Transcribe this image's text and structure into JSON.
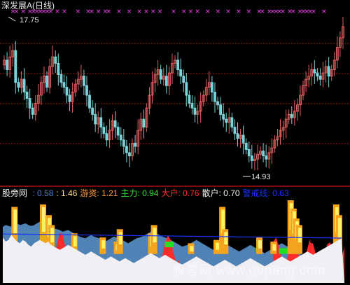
{
  "header": {
    "title": "深发展A",
    "period": "(日线)"
  },
  "indicator": {
    "name": "股旁网",
    "values": [
      {
        "label": "",
        "value": "0.58",
        "color": "#4f7fdc"
      },
      {
        "label": "",
        "value": "1.46",
        "color": "#ffe27a"
      },
      {
        "label": "游资:",
        "value": "1.21",
        "color": "#ff9a3c"
      },
      {
        "label": "主力:",
        "value": "0.94",
        "color": "#2fe02f"
      },
      {
        "label": "大户:",
        "value": "0.76",
        "color": "#ff3030"
      },
      {
        "label": "散户:",
        "value": "0.70",
        "color": "#f2f2f2"
      },
      {
        "label": "警戒线:",
        "value": "0.63",
        "color": "#1a33ff"
      }
    ]
  },
  "watermark": "股旁网  www.gupang.com",
  "colors": {
    "up": "#e06060",
    "down": "#7ad3d8",
    "grid": "#9a1a1a",
    "signal": "#ff44ff",
    "retail": "#f0f0f4",
    "mainforce": "#4f82b5",
    "hotmoney": "#f5a41f",
    "bigholder": "#ff2a2a",
    "main_green": "#22e022",
    "guard": "#1a33ff"
  },
  "chart_data": {
    "type": "candlestick",
    "price_annotations": {
      "high": "17.75",
      "low": "14.93"
    },
    "price_high": 17.75,
    "price_low": 14.93,
    "signal_marker": "×",
    "signal_positions": [
      0.03,
      0.04,
      0.06,
      0.08,
      0.09,
      0.1,
      0.11,
      0.12,
      0.13,
      0.14,
      0.16,
      0.18,
      0.22,
      0.25,
      0.26,
      0.28,
      0.3,
      0.31,
      0.34,
      0.37,
      0.4,
      0.42,
      0.44,
      0.46,
      0.5,
      0.53,
      0.55,
      0.57,
      0.6,
      0.63,
      0.66,
      0.69,
      0.72,
      0.75,
      0.76,
      0.78,
      0.79,
      0.8,
      0.81,
      0.82,
      0.84,
      0.85,
      0.87,
      0.88,
      0.89,
      0.9,
      0.91,
      0.94
    ],
    "candles_close_norm": [
      0.72,
      0.66,
      0.74,
      0.78,
      0.58,
      0.55,
      0.6,
      0.52,
      0.48,
      0.42,
      0.38,
      0.45,
      0.5,
      0.58,
      0.62,
      0.55,
      0.68,
      0.74,
      0.7,
      0.63,
      0.58,
      0.55,
      0.5,
      0.46,
      0.52,
      0.57,
      0.6,
      0.62,
      0.56,
      0.5,
      0.42,
      0.38,
      0.32,
      0.36,
      0.3,
      0.26,
      0.22,
      0.28,
      0.34,
      0.3,
      0.25,
      0.22,
      0.18,
      0.14,
      0.12,
      0.2,
      0.18,
      0.28,
      0.35,
      0.3,
      0.42,
      0.5,
      0.58,
      0.63,
      0.66,
      0.6,
      0.62,
      0.56,
      0.64,
      0.7,
      0.72,
      0.66,
      0.62,
      0.58,
      0.5,
      0.45,
      0.42,
      0.38,
      0.4,
      0.46,
      0.5,
      0.55,
      0.58,
      0.52,
      0.46,
      0.44,
      0.38,
      0.35,
      0.33,
      0.36,
      0.3,
      0.26,
      0.23,
      0.25,
      0.2,
      0.16,
      0.12,
      0.09,
      0.1,
      0.13,
      0.15,
      0.12,
      0.1,
      0.14,
      0.17,
      0.22,
      0.24,
      0.28,
      0.3,
      0.35,
      0.38,
      0.36,
      0.4,
      0.44,
      0.5,
      0.56,
      0.6,
      0.62,
      0.66,
      0.64,
      0.62,
      0.6,
      0.64,
      0.68,
      0.62,
      0.66,
      0.72,
      0.8,
      0.86,
      0.93
    ],
    "indicator_series": [
      "散户",
      "主力",
      "游资",
      "大户",
      "警戒线"
    ],
    "retail_norm": [
      0.55,
      0.5,
      0.52,
      0.58,
      0.54,
      0.5,
      0.48,
      0.52,
      0.5,
      0.46,
      0.44,
      0.48,
      0.5,
      0.52,
      0.5,
      0.48,
      0.5,
      0.46,
      0.44,
      0.42,
      0.4,
      0.42,
      0.44,
      0.46,
      0.44,
      0.42,
      0.4,
      0.38,
      0.36,
      0.34,
      0.36,
      0.38,
      0.36,
      0.34,
      0.32,
      0.3,
      0.28,
      0.3,
      0.32,
      0.3,
      0.28,
      0.26,
      0.28,
      0.3,
      0.28,
      0.26,
      0.24,
      0.26,
      0.28,
      0.3,
      0.32,
      0.34,
      0.36,
      0.34,
      0.32,
      0.3,
      0.32,
      0.34,
      0.32,
      0.3,
      0.28,
      0.26,
      0.24,
      0.22,
      0.24,
      0.26,
      0.28,
      0.3,
      0.32,
      0.3,
      0.28,
      0.26,
      0.24,
      0.22,
      0.2,
      0.22,
      0.24,
      0.26,
      0.28,
      0.26,
      0.24,
      0.22,
      0.2,
      0.22,
      0.24,
      0.26,
      0.28,
      0.3,
      0.28,
      0.26,
      0.24,
      0.22,
      0.2,
      0.22,
      0.24,
      0.26,
      0.28,
      0.3,
      0.32,
      0.3,
      0.28,
      0.26,
      0.28,
      0.3,
      0.32,
      0.34,
      0.36,
      0.38,
      0.36,
      0.34,
      0.36,
      0.38,
      0.4,
      0.42,
      0.44,
      0.46,
      0.48,
      0.5,
      0.52,
      0.54
    ],
    "main_norm": [
      0.68,
      0.7,
      0.69,
      0.68,
      0.7,
      0.72,
      0.7,
      0.71,
      0.72,
      0.7,
      0.69,
      0.7,
      0.72,
      0.74,
      0.73,
      0.72,
      0.7,
      0.68,
      0.66,
      0.65,
      0.64,
      0.62,
      0.63,
      0.64,
      0.62,
      0.6,
      0.58,
      0.56,
      0.55,
      0.54,
      0.56,
      0.58,
      0.56,
      0.55,
      0.54,
      0.52,
      0.5,
      0.52,
      0.54,
      0.56,
      0.55,
      0.54,
      0.52,
      0.5,
      0.48,
      0.5,
      0.52,
      0.54,
      0.55,
      0.56,
      0.58,
      0.6,
      0.62,
      0.61,
      0.6,
      0.58,
      0.56,
      0.55,
      0.54,
      0.52,
      0.5,
      0.48,
      0.46,
      0.44,
      0.45,
      0.46,
      0.48,
      0.5,
      0.52,
      0.5,
      0.48,
      0.46,
      0.44,
      0.42,
      0.4,
      0.42,
      0.44,
      0.46,
      0.48,
      0.46,
      0.44,
      0.42,
      0.4,
      0.38,
      0.4,
      0.42,
      0.44,
      0.46,
      0.44,
      0.42,
      0.4,
      0.38,
      0.36,
      0.38,
      0.4,
      0.42,
      0.44,
      0.46,
      0.48,
      0.46,
      0.44,
      0.42,
      0.4,
      0.38,
      0.36,
      0.34,
      0.32,
      0.3,
      0.32,
      0.34,
      0.32,
      0.3,
      0.28,
      0.26,
      0.24,
      0.22,
      0.2,
      0.18,
      0.16,
      0.14
    ],
    "hot_spikes": [
      [
        4,
        0.92
      ],
      [
        14,
        0.95
      ],
      [
        16,
        0.82
      ],
      [
        17,
        0.7
      ],
      [
        25,
        0.6
      ],
      [
        35,
        0.55
      ],
      [
        40,
        0.5
      ],
      [
        41,
        0.65
      ],
      [
        52,
        0.6
      ],
      [
        53,
        0.7
      ],
      [
        66,
        0.48
      ],
      [
        75,
        0.52
      ],
      [
        77,
        0.92
      ],
      [
        78,
        0.65
      ],
      [
        90,
        0.55
      ],
      [
        95,
        0.5
      ],
      [
        101,
        1.0
      ],
      [
        102,
        0.9
      ],
      [
        103,
        0.78
      ],
      [
        104,
        0.7
      ],
      [
        117,
        0.95
      ],
      [
        118,
        0.82
      ]
    ],
    "big_bands": [
      [
        18,
        22,
        0.62
      ],
      [
        55,
        62,
        0.58
      ],
      [
        95,
        108,
        0.55
      ],
      [
        108,
        120,
        0.5
      ]
    ],
    "green_bands": [
      [
        57,
        60,
        0.5
      ],
      [
        97,
        104,
        0.42
      ]
    ],
    "guard_level": 0.63
  }
}
